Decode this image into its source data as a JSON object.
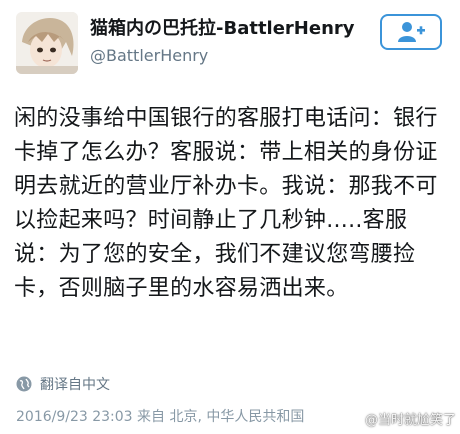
{
  "header": {
    "display_name": "猫箱内の巴托拉-BattlerHenry",
    "handle": "@BattlerHenry",
    "avatar_icon": "user-avatar-image",
    "follow_icon": "add-user-icon",
    "accent_color": "#3b94d9"
  },
  "tweet": {
    "text": "闲的没事给中国银行的客服打电话问：银行卡掉了怎么办？客服说：带上相关的身份证明去就近的营业厅补办卡。我说：那我不可以捡起来吗？时间静止了几秒钟.....客服说：为了您的安全，我们不建议您弯腰捡卡，否则脑子里的水容易洒出来。"
  },
  "translate": {
    "icon": "globe-icon",
    "label": "翻译自中文"
  },
  "meta": {
    "timestamp": "2016/9/23 23:03",
    "from_label": "来自",
    "location": "北京, 中华人民共和国"
  },
  "watermark": {
    "text": "@当时就尬笑了"
  }
}
